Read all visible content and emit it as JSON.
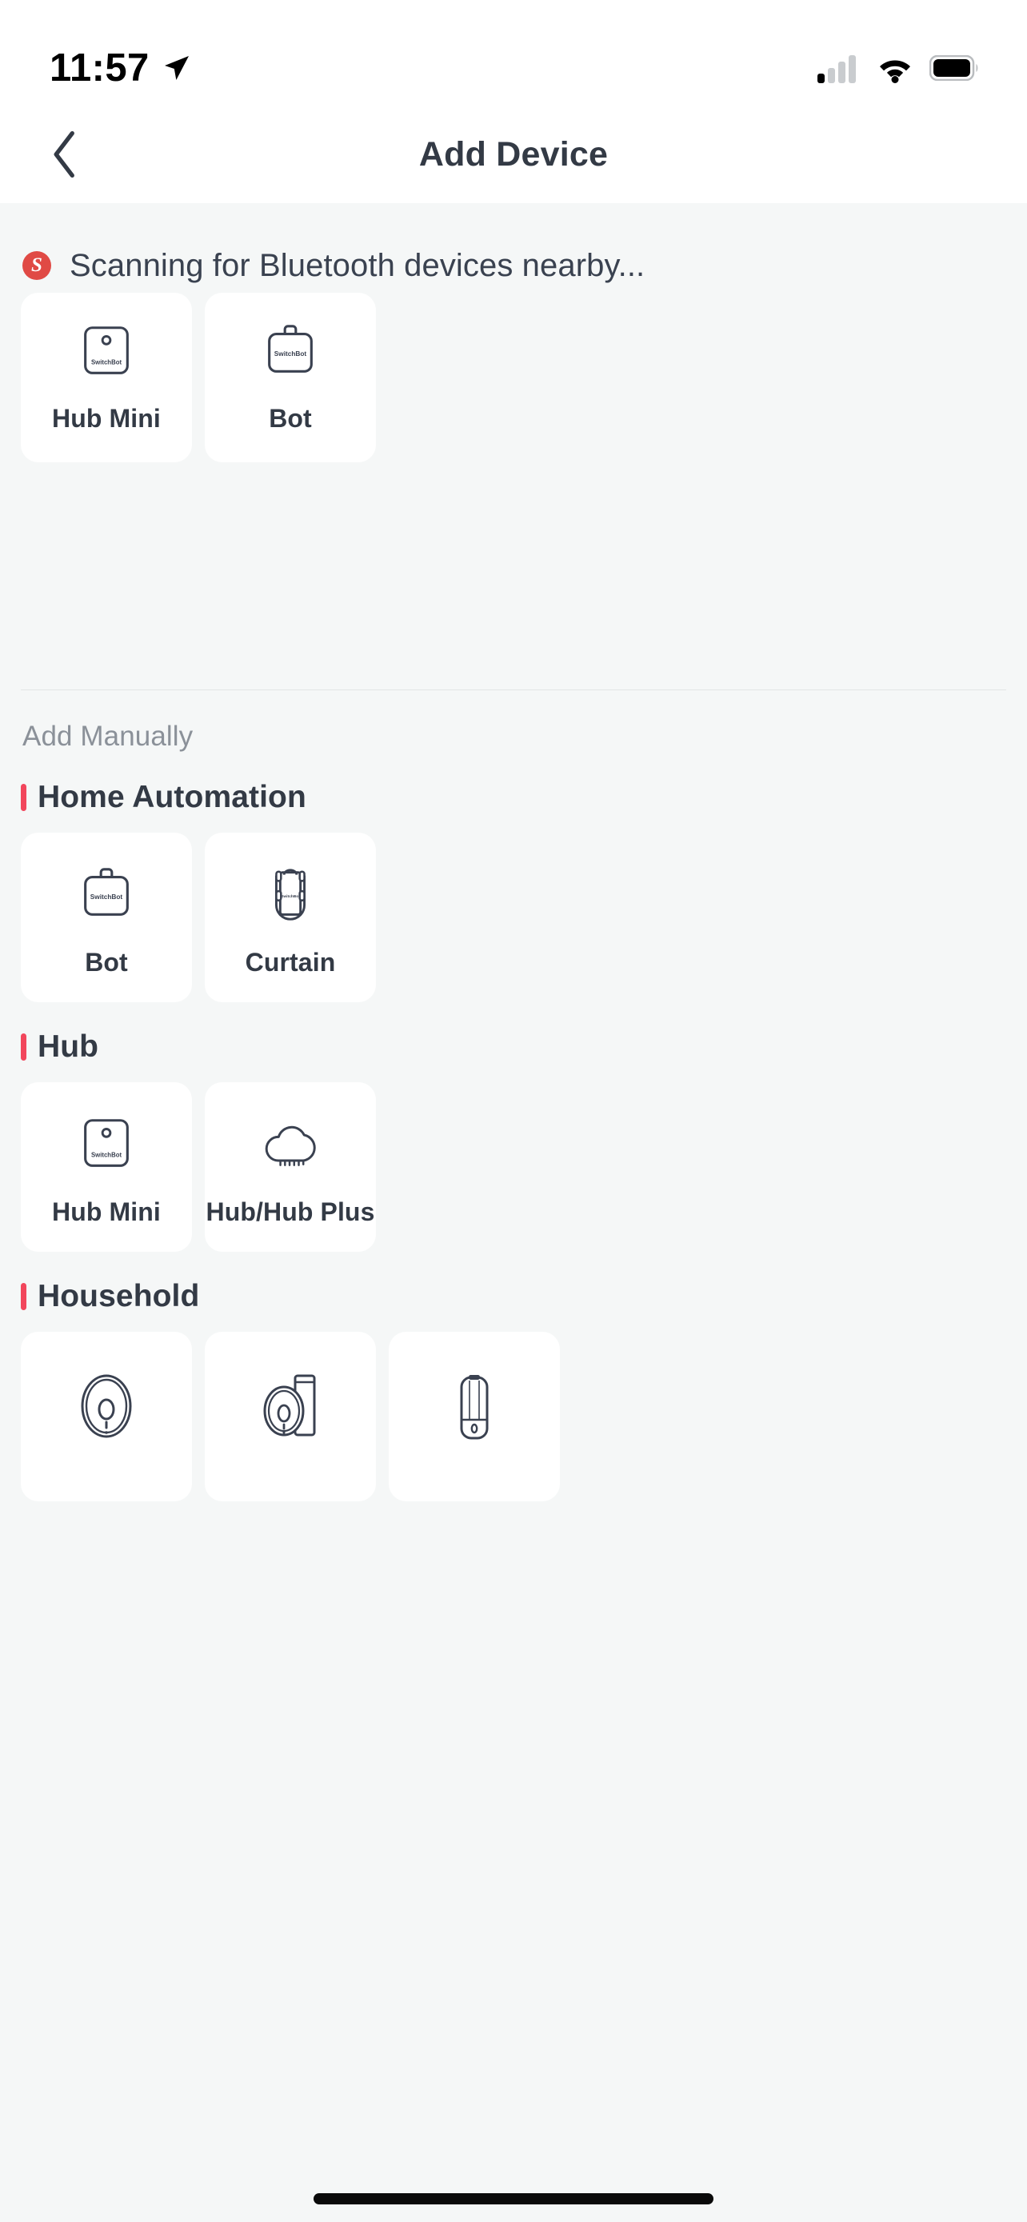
{
  "status_bar": {
    "time": "11:57",
    "location_icon": "location-arrow-icon",
    "signal_icon": "cellular-signal-icon",
    "wifi_icon": "wifi-icon",
    "battery_icon": "battery-full-icon"
  },
  "nav": {
    "back_icon": "chevron-left-icon",
    "title": "Add Device"
  },
  "scan": {
    "badge_letter": "S",
    "badge_color": "#e04a45",
    "text": "Scanning for Bluetooth devices nearby...",
    "results": [
      {
        "label": "Hub Mini",
        "icon": "hub-mini-icon",
        "brand": "SwitchBot"
      },
      {
        "label": "Bot",
        "icon": "bot-icon",
        "brand": "SwitchBot"
      }
    ]
  },
  "manual": {
    "heading": "Add Manually",
    "accent_color": "#f2465c",
    "sections": [
      {
        "title": "Home Automation",
        "devices": [
          {
            "label": "Bot",
            "icon": "bot-icon",
            "brand": "SwitchBot"
          },
          {
            "label": "Curtain",
            "icon": "curtain-icon",
            "brand": "SwitchBot"
          }
        ]
      },
      {
        "title": "Hub",
        "devices": [
          {
            "label": "Hub Mini",
            "icon": "hub-mini-icon",
            "brand": "SwitchBot"
          },
          {
            "label": "Hub/Hub Plus",
            "icon": "hub-cloud-icon",
            "brand": "SwitchBot"
          }
        ]
      },
      {
        "title": "Household",
        "devices": [
          {
            "label": "",
            "icon": "robot-vacuum-icon",
            "brand": ""
          },
          {
            "label": "",
            "icon": "robot-vacuum-dock-icon",
            "brand": ""
          },
          {
            "label": "",
            "icon": "humidifier-icon",
            "brand": ""
          }
        ]
      }
    ]
  },
  "colors": {
    "background": "#f5f7f7",
    "card": "#ffffff",
    "text_primary": "#333a45",
    "text_muted": "#8b9199",
    "accent_red": "#f2465c",
    "icon_stroke": "#3a4150"
  }
}
